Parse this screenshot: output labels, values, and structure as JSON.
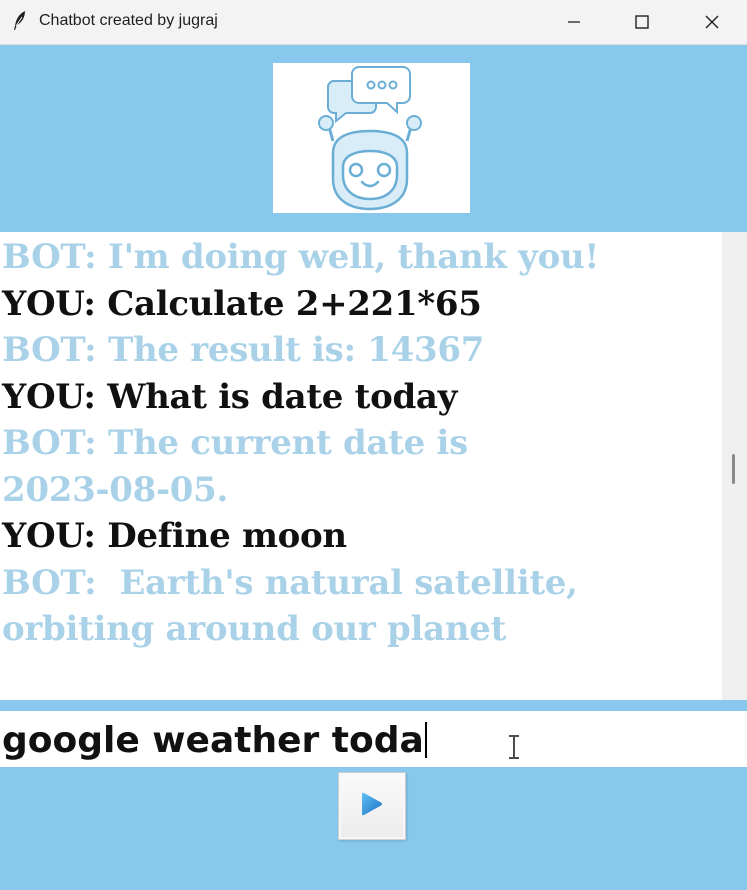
{
  "window": {
    "title": "Chatbot created by jugraj"
  },
  "colors": {
    "background": "#87c8ec",
    "bot_text": "#a9d2e9",
    "you_text": "#111111",
    "send_icon": "#2f8fd8"
  },
  "icons": {
    "app": "feather-icon",
    "logo": "robot-chat-icon",
    "send": "play-arrow-icon"
  },
  "chat": {
    "lines": [
      {
        "role": "bot",
        "text": "BOT: I'm doing well, thank you!"
      },
      {
        "role": "you",
        "text": "YOU: Calculate 2+221*65"
      },
      {
        "role": "bot",
        "text": "BOT: The result is: 14367"
      },
      {
        "role": "you",
        "text": "YOU: What is date today"
      },
      {
        "role": "bot",
        "text": "BOT: The current date is"
      },
      {
        "role": "bot",
        "text": "2023-08-05."
      },
      {
        "role": "you",
        "text": "YOU: Define moon"
      },
      {
        "role": "bot",
        "text": "BOT:  Earth's natural satellite,"
      },
      {
        "role": "bot",
        "text": "orbiting around our planet"
      }
    ]
  },
  "input": {
    "value": "google weather toda"
  }
}
